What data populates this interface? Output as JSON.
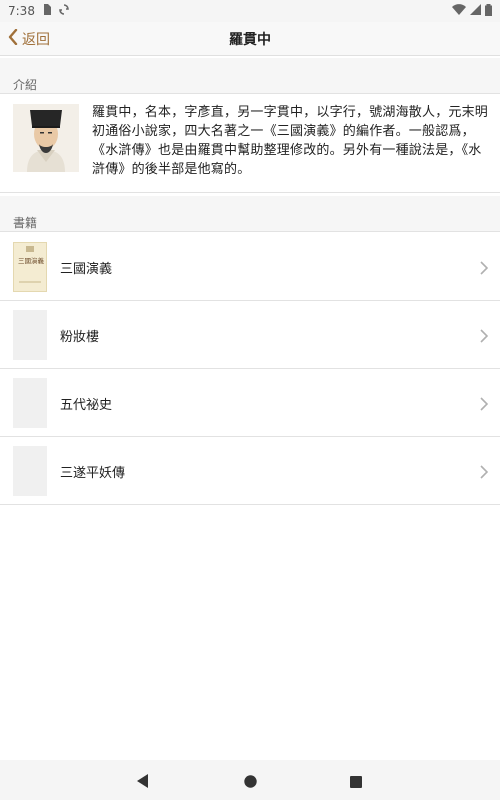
{
  "status_bar": {
    "time": "7:38"
  },
  "nav": {
    "back_label": "返回",
    "title": "羅貫中"
  },
  "sections": {
    "intro_header": "介紹",
    "books_header": "書籍"
  },
  "intro": {
    "text": "羅貫中，名本，字彥直，另一字貫中，以字行，號湖海散人，元末明初通俗小說家，四大名著之一《三國演義》的編作者。一般認爲，《水滸傳》也是由羅貫中幫助整理修改的。另外有一種說法是，《水滸傳》的後半部是他寫的。"
  },
  "books": [
    {
      "title": "三國演義",
      "cover_text": "三國演義"
    },
    {
      "title": "粉妝樓"
    },
    {
      "title": "五代祕史"
    },
    {
      "title": "三遂平妖傳"
    }
  ],
  "colors": {
    "accent": "#a0703a",
    "divider": "#e2e2e2",
    "section_bg": "#f6f6f6"
  }
}
